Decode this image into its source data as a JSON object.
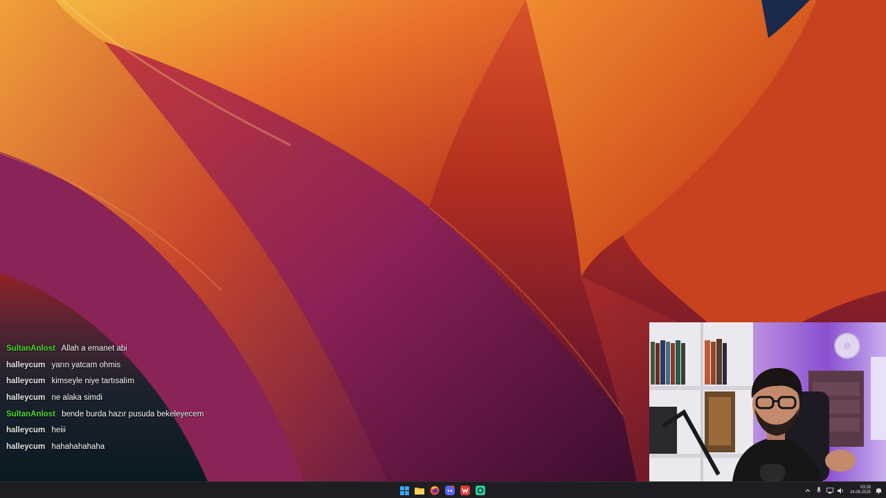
{
  "chat": {
    "messages": [
      {
        "user": "SultanAnlost",
        "text": "Allah a emanet abi",
        "color": "#4ddc2e"
      },
      {
        "user": "halleycum",
        "text": "yarın yatcam ohmis",
        "color": "#e6e6e6"
      },
      {
        "user": "halleycum",
        "text": "kimseyle niye tartısalım",
        "color": "#e6e6e6"
      },
      {
        "user": "halleycum",
        "text": "ne alaka simdi",
        "color": "#e6e6e6"
      },
      {
        "user": "SultanAnlost",
        "text": "bende burda hazır pusuda bekeleyecem",
        "color": "#4ddc2e"
      },
      {
        "user": "halleycum",
        "text": "heiii",
        "color": "#e6e6e6"
      },
      {
        "user": "halleycum",
        "text": "hahahahahaha",
        "color": "#e6e6e6"
      }
    ]
  },
  "taskbar": {
    "apps": [
      "windows-start-icon",
      "file-explorer-icon",
      "firefox-icon",
      "discord-icon",
      "wps-office-icon",
      "chatgpt-app-icon"
    ],
    "clock": {
      "time": "03:28",
      "date": "24.08.2025"
    }
  },
  "colors": {
    "chat_green": "#4ddc2e",
    "chat_white": "#e6e6e6",
    "taskbar_bg": "#1d1d22"
  }
}
